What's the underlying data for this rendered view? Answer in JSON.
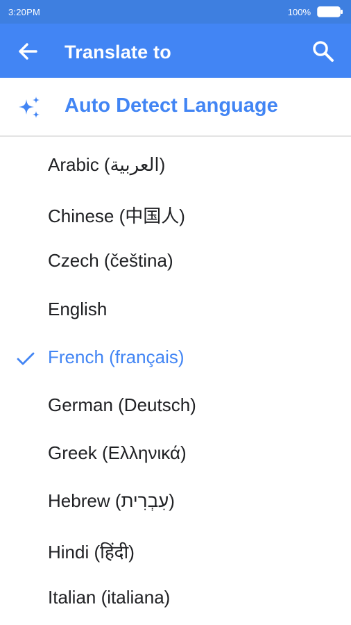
{
  "status_bar": {
    "time": "3:20PM",
    "battery_percent": "100%",
    "battery_icon": "battery-full-icon"
  },
  "app_bar": {
    "title": "Translate to",
    "back_icon": "arrow-left-icon",
    "search_icon": "search-icon",
    "background_color": "#4285f4"
  },
  "auto_detect": {
    "label": "Auto Detect Language",
    "icon": "sparkle-icon",
    "color": "#4285f4"
  },
  "languages": [
    {
      "label": "Arabic (العربية)",
      "selected": false
    },
    {
      "label": "Chinese (中国人)",
      "selected": false
    },
    {
      "label": "Czech (čeština)",
      "selected": false
    },
    {
      "label": "English",
      "selected": false
    },
    {
      "label": "French (français)",
      "selected": true
    },
    {
      "label": "German (Deutsch)",
      "selected": false
    },
    {
      "label": "Greek (Ελληνικά)",
      "selected": false
    },
    {
      "label": "Hebrew (עִבְרִית)",
      "selected": false
    },
    {
      "label": "Hindi (हिंदी)",
      "selected": false
    },
    {
      "label": "Italian (italiana)",
      "selected": false
    }
  ]
}
